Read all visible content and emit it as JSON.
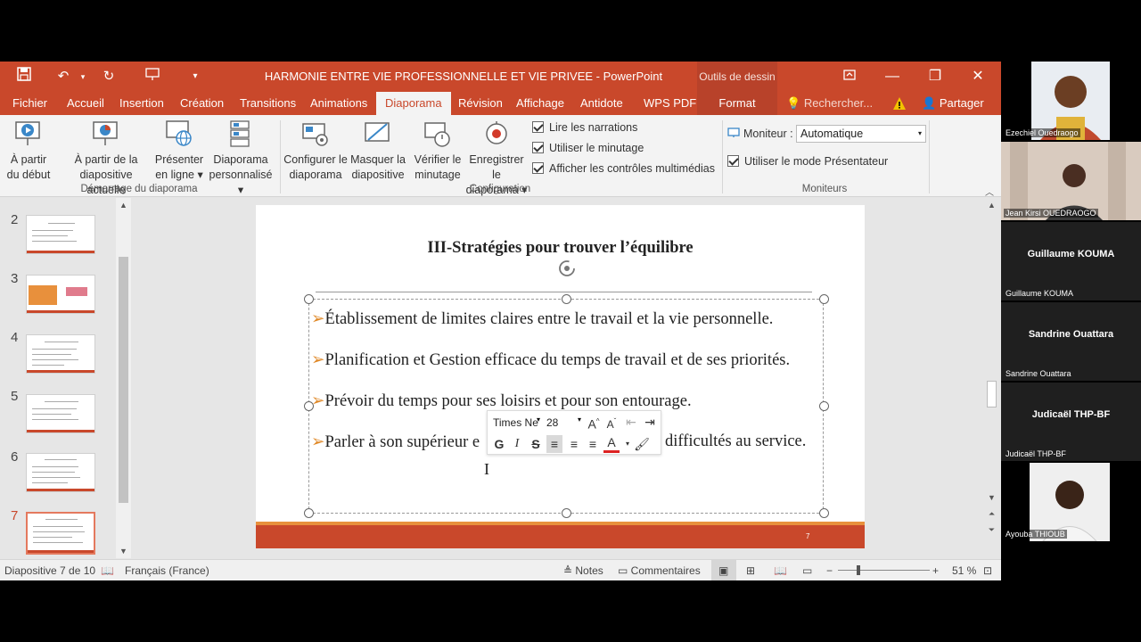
{
  "window": {
    "title": "HARMONIE ENTRE VIE PROFESSIONNELLE ET VIE PRIVEE  -  PowerPoint",
    "context_label": "Outils de dessin"
  },
  "tabs": [
    "Fichier",
    "Accueil",
    "Insertion",
    "Création",
    "Transitions",
    "Animations",
    "Diaporama",
    "Révision",
    "Affichage",
    "Antidote",
    "WPS PDF",
    "Format"
  ],
  "active_tab": "Diaporama",
  "search_placeholder": "Rechercher...",
  "share_label": "Partager",
  "ribbon": {
    "group1": {
      "label": "Démarrage du diaporama",
      "buttons": [
        {
          "line1": "À partir",
          "line2": "du début"
        },
        {
          "line1": "À partir de la",
          "line2": "diapositive actuelle"
        },
        {
          "line1": "Présenter",
          "line2": "en ligne ▾"
        },
        {
          "line1": "Diaporama",
          "line2": "personnalisé ▾"
        }
      ]
    },
    "group2": {
      "label": "Configuration",
      "buttons": [
        {
          "line1": "Configurer le",
          "line2": "diaporama"
        },
        {
          "line1": "Masquer la",
          "line2": "diapositive"
        },
        {
          "line1": "Vérifier le",
          "line2": "minutage"
        },
        {
          "line1": "Enregistrer le",
          "line2": "diaporama ▾"
        }
      ],
      "checkboxes": [
        "Lire les narrations",
        "Utiliser le minutage",
        "Afficher les contrôles multimédias"
      ]
    },
    "group3": {
      "label": "Moniteurs",
      "monitor_label": "Moniteur :",
      "monitor_value": "Automatique",
      "presenter_checkbox": "Utiliser le mode Présentateur"
    }
  },
  "thumbnails": [
    "2",
    "3",
    "4",
    "5",
    "6",
    "7"
  ],
  "slide": {
    "title": "III-Stratégies pour trouver l’équilibre",
    "bullets": [
      "Établissement de limites claires entre le travail et la vie personnelle.",
      "Planification et Gestion efficace du temps de travail et de ses priorités.",
      "Prévoir du temps pour ses loisirs et pour son entourage.",
      "Parler à son supérieur e"
    ],
    "bullet4_tail": "difficultés au service.",
    "number": "7"
  },
  "mini_toolbar": {
    "font": "Times Ne",
    "size": "28",
    "bold": "G",
    "italic": "I",
    "strike": "S"
  },
  "status": {
    "slide_info": "Diapositive 7 de 10",
    "language": "Français (France)",
    "notes": "Notes",
    "comments": "Commentaires",
    "zoom": "51 %"
  },
  "participants": [
    {
      "name": "Ezechiel Ouedraogo",
      "video": true
    },
    {
      "name": "Jean Kirsi OUEDRAOGO",
      "video": true
    },
    {
      "name": "Guillaume KOUMA",
      "video": false
    },
    {
      "name": "Sandrine Ouattara",
      "video": false
    },
    {
      "name": "Judicaël THP-BF",
      "video": false
    },
    {
      "name": "Ayouba THIOUB",
      "video": true
    }
  ]
}
